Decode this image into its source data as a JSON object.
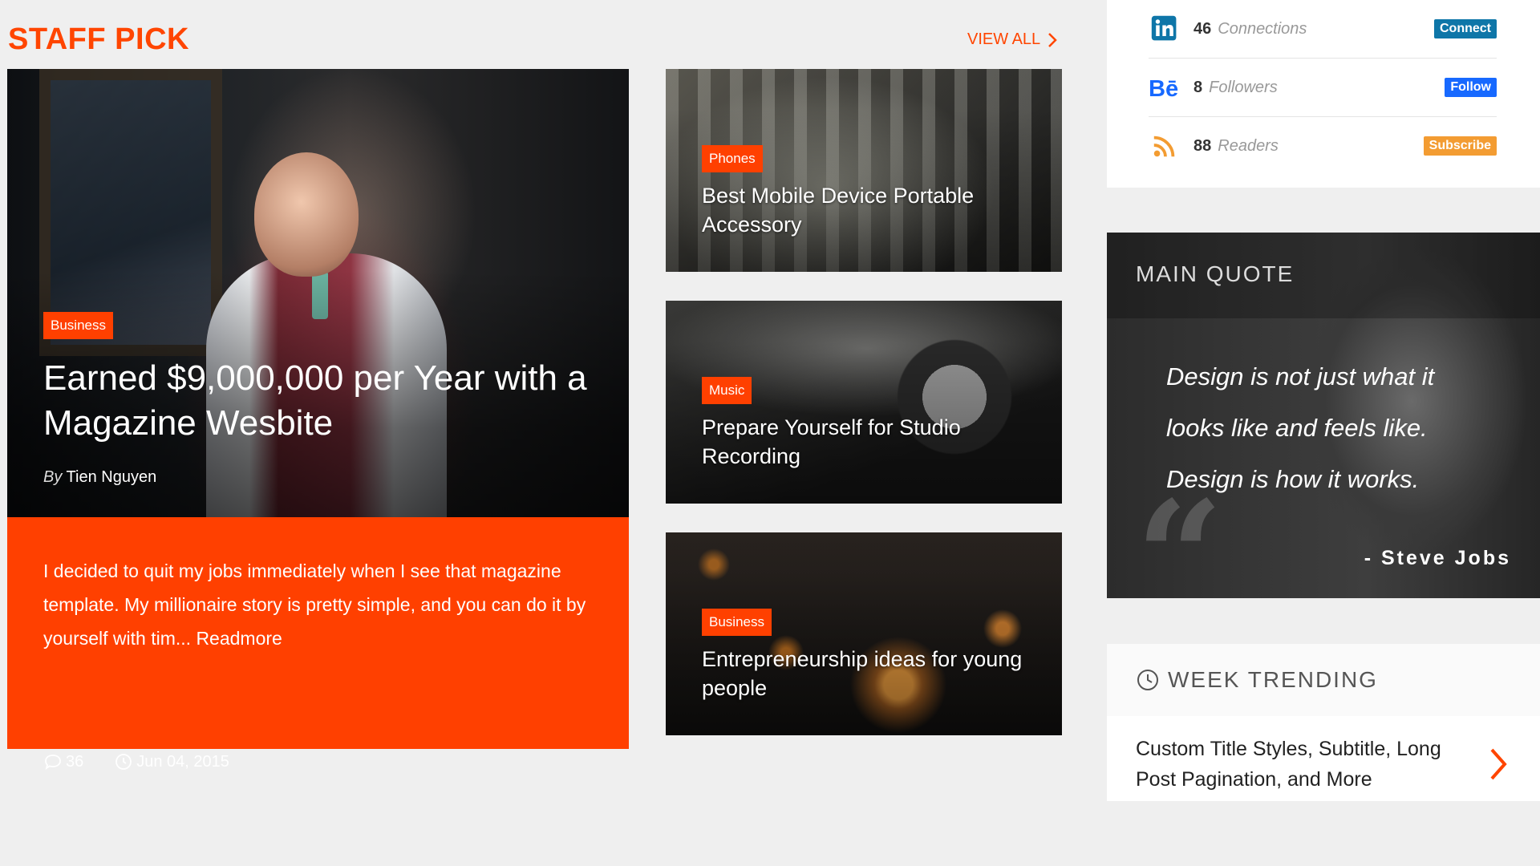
{
  "staff_pick": {
    "title": "STAFF PICK",
    "view_all": "VIEW ALL"
  },
  "feature": {
    "category": "Business",
    "title": "Earned $9,000,000 per Year with a Magazine Wesbite",
    "by": "By",
    "author": "Tien Nguyen",
    "excerpt": "I decided to quit my jobs immediately when I see that magazine template. My millionaire story is pretty simple, and you can do it by yourself with tim...",
    "readmore": "Readmore",
    "comments": "36",
    "date": "Jun 04, 2015"
  },
  "cards": [
    {
      "category": "Phones",
      "title": "Best Mobile Device Portable Accessory"
    },
    {
      "category": "Music",
      "title": "Prepare Yourself for Studio Recording"
    },
    {
      "category": "Business",
      "title": "Entrepreneurship ideas for young people"
    }
  ],
  "social": [
    {
      "network": "linkedin",
      "icon": "linkedin-icon",
      "count": "46",
      "label": "Connections",
      "button": "Connect",
      "color": "#0e76a8"
    },
    {
      "network": "behance",
      "icon": "behance-icon",
      "count": "8",
      "label": "Followers",
      "button": "Follow",
      "color": "#1769ff"
    },
    {
      "network": "rss",
      "icon": "rss-icon",
      "count": "88",
      "label": "Readers",
      "button": "Subscribe",
      "color": "#f39c32"
    }
  ],
  "quote": {
    "title": "MAIN QUOTE",
    "text": "Design is not just what it looks like and feels like. Design is how it works.",
    "author": "- Steve Jobs"
  },
  "trending": {
    "title": "WEEK TRENDING",
    "item": "Custom Title Styles, Subtitle, Long Post Pagination, and More"
  },
  "colors": {
    "accent": "#ff4500",
    "feature_bg": "#ff4000"
  }
}
